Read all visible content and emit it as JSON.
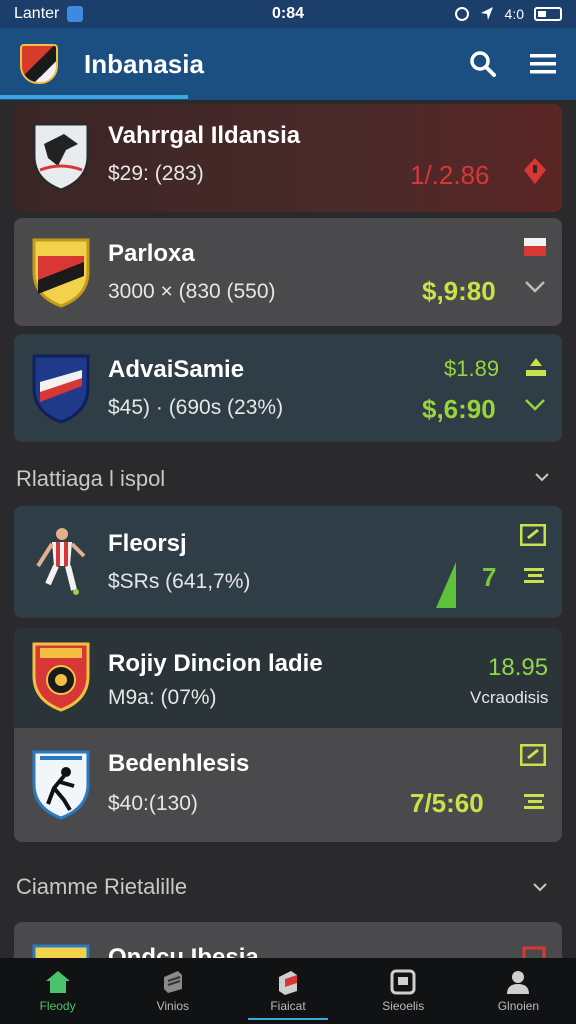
{
  "status_bar": {
    "carrier": "Lanter",
    "time": "0:84",
    "signal_text": "4:0",
    "accent": "#3d8be0"
  },
  "header": {
    "title": "Inbanasia",
    "search_icon": "search-icon",
    "menu_icon": "menu-icon"
  },
  "cards_top": [
    {
      "name": "Vahrrgal Ildansia",
      "sub": "$29: (283)",
      "value": "1/.2.86",
      "value_color": "#d93636",
      "indicator": "alert-diamond-icon",
      "indicator_color": "#d93636"
    },
    {
      "name": "Parloxa",
      "sub": "3000 × (830 (550)",
      "value": "$,9:80",
      "value_color": "#c9e24a",
      "indicator": "chevron-down-icon",
      "top_icon": "flag-icon"
    },
    {
      "name": "AdvaiSamie",
      "sub": "$45) · (690s (23%)",
      "value_top": "$1.89",
      "value": "$,6:90",
      "value_color": "#9ad33a",
      "indicator": "chevron-down-icon"
    }
  ],
  "section1": {
    "title": "Rlattiaga l ispol"
  },
  "cards_mid": [
    {
      "name": "Fleorsj",
      "sub": "$SRs (641,7%)",
      "value": "7",
      "value_color": "#79c93c",
      "indicator": "list-icon"
    },
    {
      "name": "Rojiy Dincion ladie",
      "sub": "M9a: (07%)",
      "value": "18.95",
      "value_note": "Vcraodisis",
      "value_color": "#8fd84a"
    },
    {
      "name": "Bedenhlesis",
      "sub": "$40:(130)",
      "value": "7/5:60",
      "value_color": "#c9e24a",
      "indicator": "list-icon"
    }
  ],
  "section2": {
    "title": "Ciamme Rietalille"
  },
  "cards_bottom": [
    {
      "name": "Ondcu Ibesia"
    }
  ],
  "bottom_nav": [
    {
      "label": "Fleody",
      "icon": "home-icon",
      "active": true
    },
    {
      "label": "Vinios",
      "icon": "cube-icon",
      "active": false
    },
    {
      "label": "Fiaicat",
      "icon": "box-icon",
      "active": false
    },
    {
      "label": "Sieoelis",
      "icon": "window-icon",
      "active": false
    },
    {
      "label": "Glnoien",
      "icon": "user-icon",
      "active": false
    }
  ]
}
